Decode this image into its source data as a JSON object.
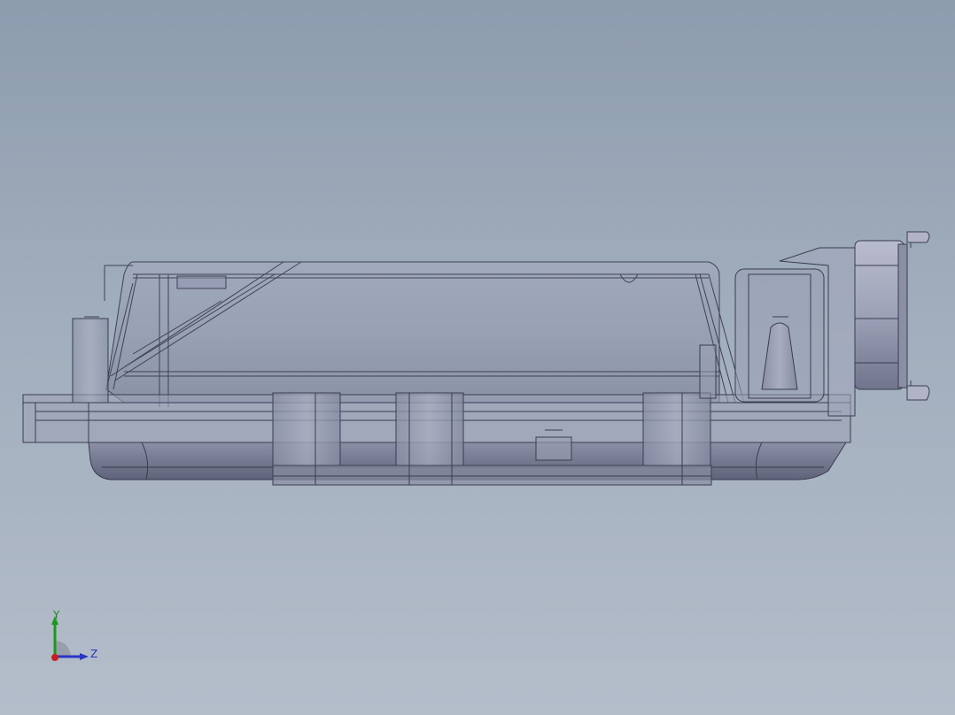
{
  "viewport": {
    "background_top": "#8d9cae",
    "background_bottom": "#b4bdca",
    "render_mode": "shaded-with-edges-transparent"
  },
  "triad": {
    "y_label": "Y",
    "z_label": "Z",
    "y_color": "#1a9a1a",
    "z_color": "#2a34c8",
    "x_color": "#c82020"
  }
}
